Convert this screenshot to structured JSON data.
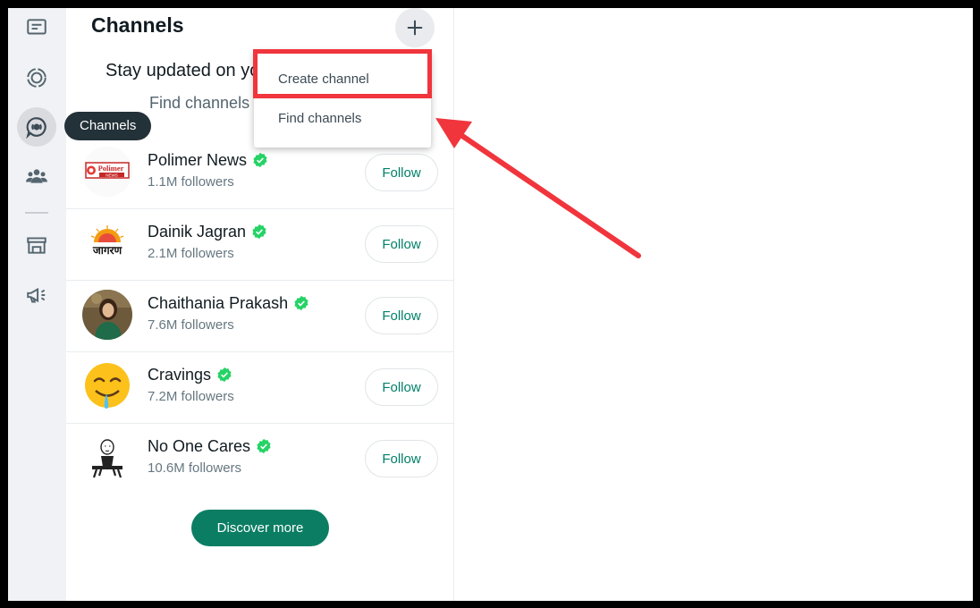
{
  "sidebar": {
    "tooltip": "Channels",
    "icons": [
      "chats-icon",
      "status-icon",
      "channels-icon",
      "communities-icon",
      "store-icon",
      "megaphone-icon"
    ]
  },
  "panel": {
    "title": "Channels",
    "subtitle": "Stay updated on your favorite topics",
    "find_link": "Find channels below"
  },
  "menu": {
    "items": [
      "Create channel",
      "Find channels"
    ]
  },
  "channels": [
    {
      "name": "Polimer News",
      "followers": "1.1M followers",
      "follow_label": "Follow"
    },
    {
      "name": "Dainik Jagran",
      "followers": "2.1M followers",
      "follow_label": "Follow"
    },
    {
      "name": "Chaithania Prakash",
      "followers": "7.6M followers",
      "follow_label": "Follow"
    },
    {
      "name": "Cravings",
      "followers": "7.2M followers",
      "follow_label": "Follow"
    },
    {
      "name": "No One Cares",
      "followers": "10.6M followers",
      "follow_label": "Follow"
    }
  ],
  "avatar_text": {
    "polimer": "Polimer",
    "polimer_sub": "NEWS",
    "jagran": "जागरण"
  },
  "discover_label": "Discover more",
  "colors": {
    "accent": "#008069",
    "discover_bg": "#0b7d63",
    "verified": "#25d366",
    "annotation": "#f0353c",
    "tooltip_bg": "#233138"
  }
}
